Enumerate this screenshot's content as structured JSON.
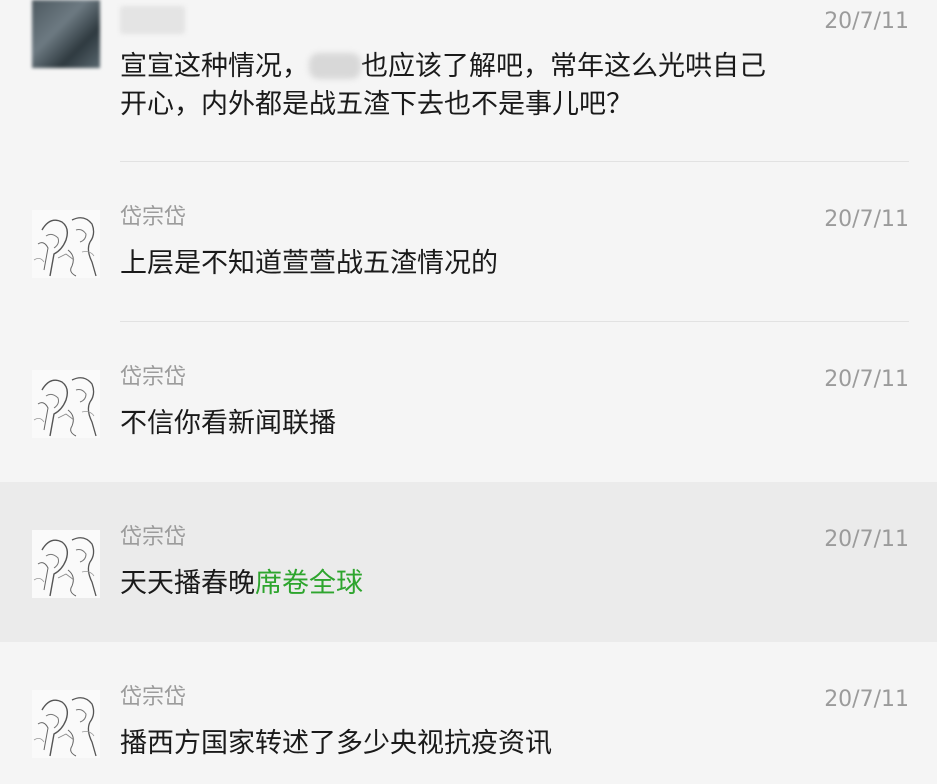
{
  "comments": [
    {
      "username": "",
      "time": "20/7/11",
      "text_before": "宣宣这种情况，",
      "text_after": "也应该了解吧，常年这么光哄自己开心，内外都是战五渣下去也不是事儿吧？"
    },
    {
      "username": "岱宗岱",
      "time": "20/7/11",
      "text": "上层是不知道萱萱战五渣情况的"
    },
    {
      "username": "岱宗岱",
      "time": "20/7/11",
      "text": "不信你看新闻联播"
    },
    {
      "username": "岱宗岱",
      "time": "20/7/11",
      "text": "天天播春晚",
      "text_green": "席卷全球"
    },
    {
      "username": "岱宗岱",
      "time": "20/7/11",
      "text": "播西方国家转述了多少央视抗疫资讯"
    }
  ],
  "icons": {
    "avatar_user": "anime-sketch-avatar-icon",
    "avatar_redacted": "blurred-avatar-icon"
  },
  "colors": {
    "background": "#f5f5f5",
    "highlight": "#ebebeb",
    "meta_text": "#9b9b9b",
    "body_text": "#1a1a1a",
    "link_green": "#2ea52e",
    "divider": "#e2e2e2"
  }
}
